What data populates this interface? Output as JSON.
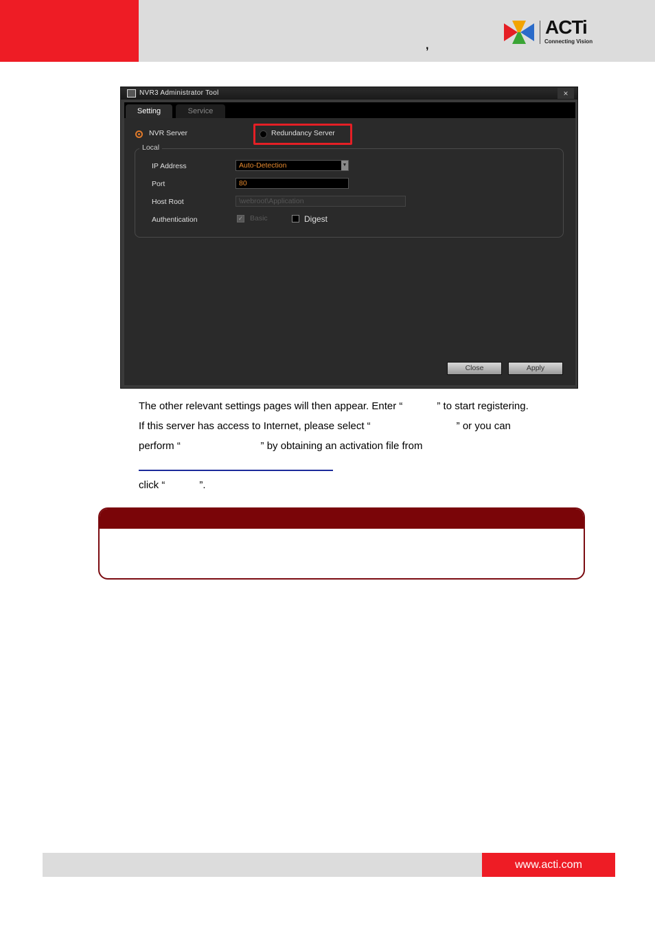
{
  "header": {
    "comma": ","
  },
  "logo": {
    "text": "ACTi",
    "tagline": "Connecting Vision"
  },
  "window": {
    "title": "NVR3 Administrator Tool",
    "close_glyph": "×",
    "tabs": [
      {
        "label": "Setting"
      },
      {
        "label": "Service"
      }
    ],
    "server_options": {
      "nvr": "NVR Server",
      "redundancy": "Redundancy Server"
    },
    "group_label": "Local",
    "fields": {
      "ip_label": "IP Address",
      "ip_value": "Auto-Detection",
      "port_label": "Port",
      "port_value": "80",
      "host_label": "Host Root",
      "host_value": "\\webroot\\Application",
      "auth_label": "Authentication",
      "auth_basic": "Basic",
      "auth_digest": "Digest"
    },
    "buttons": {
      "close": "Close",
      "apply": "Apply"
    }
  },
  "body": {
    "line1": "The other relevant settings pages will then appear. Enter “            ” to start registering.",
    "line2": "If this server has access to Internet, please select “                              ” or you can",
    "line3": "perform “                            ” by obtaining an activation file from",
    "line4": "click “            ”."
  },
  "footer": {
    "url": "www.acti.com"
  },
  "colors": {
    "brand_red": "#ee1c25",
    "note_header": "#7a0508",
    "accent_orange": "#e6892d"
  }
}
